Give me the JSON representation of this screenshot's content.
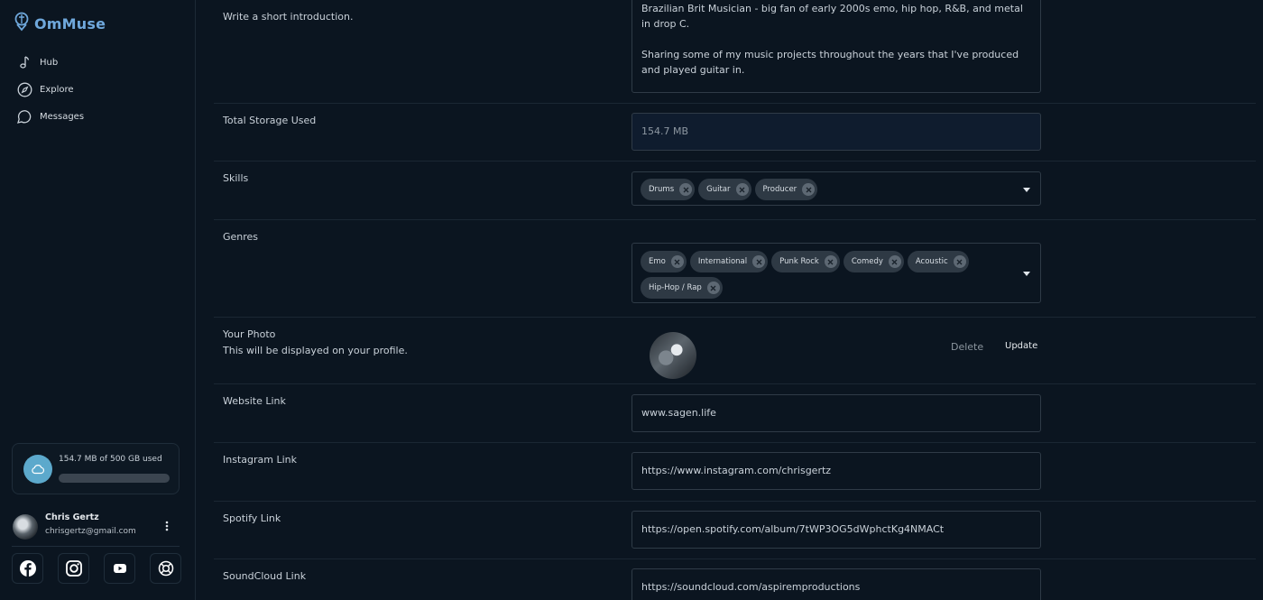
{
  "app": {
    "name": "OmMuse",
    "brand_color": "#6fa8dc"
  },
  "sidebar": {
    "nav": [
      {
        "label": "Hub",
        "icon": "music-note-icon"
      },
      {
        "label": "Explore",
        "icon": "compass-icon"
      },
      {
        "label": "Messages",
        "icon": "chat-icon"
      }
    ],
    "storage": {
      "text": "154.7 MB of 500 GB used",
      "used_fraction": 0.0003,
      "icon": "cloud-icon"
    },
    "user": {
      "name": "Chris Gertz",
      "email": "chrisgertz@gmail.com"
    },
    "socials": [
      "facebook-icon",
      "instagram-icon",
      "youtube-icon",
      "lifebuoy-icon"
    ]
  },
  "form": {
    "bio": {
      "label": "Write a short introduction.",
      "line1": "Brazilian Brit Musician - big fan of early 2000s emo, hip hop, R&B, and metal in drop C.",
      "line2": "Sharing some of my music projects throughout the years that I've produced and played guitar in."
    },
    "storage": {
      "label": "Total Storage Used",
      "value": "154.7 MB"
    },
    "skills": {
      "label": "Skills",
      "chips": [
        "Drums",
        "Guitar",
        "Producer"
      ]
    },
    "genres": {
      "label": "Genres",
      "chips": [
        "Emo",
        "International",
        "Punk Rock",
        "Comedy",
        "Acoustic",
        "Hip-Hop / Rap"
      ]
    },
    "photo": {
      "label": "Your Photo",
      "sublabel": "This will be displayed on your profile.",
      "delete_label": "Delete",
      "update_label": "Update"
    },
    "website": {
      "label": "Website Link",
      "value": "www.sagen.life"
    },
    "instagram": {
      "label": "Instagram Link",
      "value": "https://www.instagram.com/chrisgertz"
    },
    "spotify": {
      "label": "Spotify Link",
      "value": "https://open.spotify.com/album/7tWP3OG5dWphctKg4NMACt"
    },
    "soundcloud": {
      "label": "SoundCloud Link",
      "value": "https://soundcloud.com/aspiremproductions"
    }
  }
}
